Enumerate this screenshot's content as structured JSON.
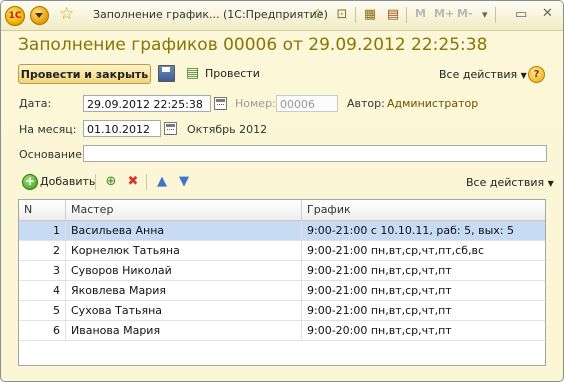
{
  "window": {
    "title": "Заполнение график... (1С:Предприятие)",
    "logo_text": "1С",
    "toolbar_icons": [
      "menu-icon",
      "star-icon",
      "add-favorite-icon",
      "history-icon",
      "calculator-icon",
      "calendar-icon",
      "memory-m-icon",
      "memory-m-plus-icon",
      "memory-m-minus-icon",
      "dropdown-icon",
      "minimize-icon",
      "close-icon"
    ],
    "mem_labels": [
      "M",
      "M+",
      "M-"
    ]
  },
  "document": {
    "title": "Заполнение графиков 00006 от 29.09.2012 22:25:38"
  },
  "command_bar": {
    "post_and_close": "Провести и закрыть",
    "post": "Провести",
    "all_actions": "Все действия",
    "help": "?"
  },
  "form": {
    "date_label": "Дата:",
    "date_value": "29.09.2012 22:25:38",
    "number_label": "Номер:",
    "number_value": "00006",
    "author_label": "Автор:",
    "author_value": "Администратор",
    "month_label": "На месяц:",
    "month_value": "01.10.2012",
    "month_text": "Октябрь 2012",
    "basis_label": "Основание:",
    "basis_value": ""
  },
  "table_bar": {
    "add": "Добавить",
    "all_actions": "Все действия"
  },
  "table": {
    "columns": [
      "N",
      "Мастер",
      "График"
    ],
    "rows": [
      {
        "n": "1",
        "master": "Васильева Анна",
        "schedule": "9:00-21:00 с 10.10.11, раб: 5, вых: 5",
        "selected": true
      },
      {
        "n": "2",
        "master": "Корнелюк Татьяна",
        "schedule": "9:00-21:00 пн,вт,ср,чт,пт,сб,вс",
        "selected": false
      },
      {
        "n": "3",
        "master": "Суворов Николай",
        "schedule": "9:00-21:00 пн,вт,ср,чт,пт",
        "selected": false
      },
      {
        "n": "4",
        "master": "Яковлева Мария",
        "schedule": "9:00-21:00 пн,вт,ср,чт,пт",
        "selected": false
      },
      {
        "n": "5",
        "master": "Сухова Татьяна",
        "schedule": "9:00-21:00 пн,вт,ср,чт,пт",
        "selected": false
      },
      {
        "n": "6",
        "master": "Иванова Мария",
        "schedule": "9:00-20:00 пн,вт,ср,чт,пт",
        "selected": false
      }
    ]
  },
  "colors": {
    "title_accent": "#8b7500",
    "selection": "#c7dcf4",
    "window_bg": "#fbf6d3"
  }
}
